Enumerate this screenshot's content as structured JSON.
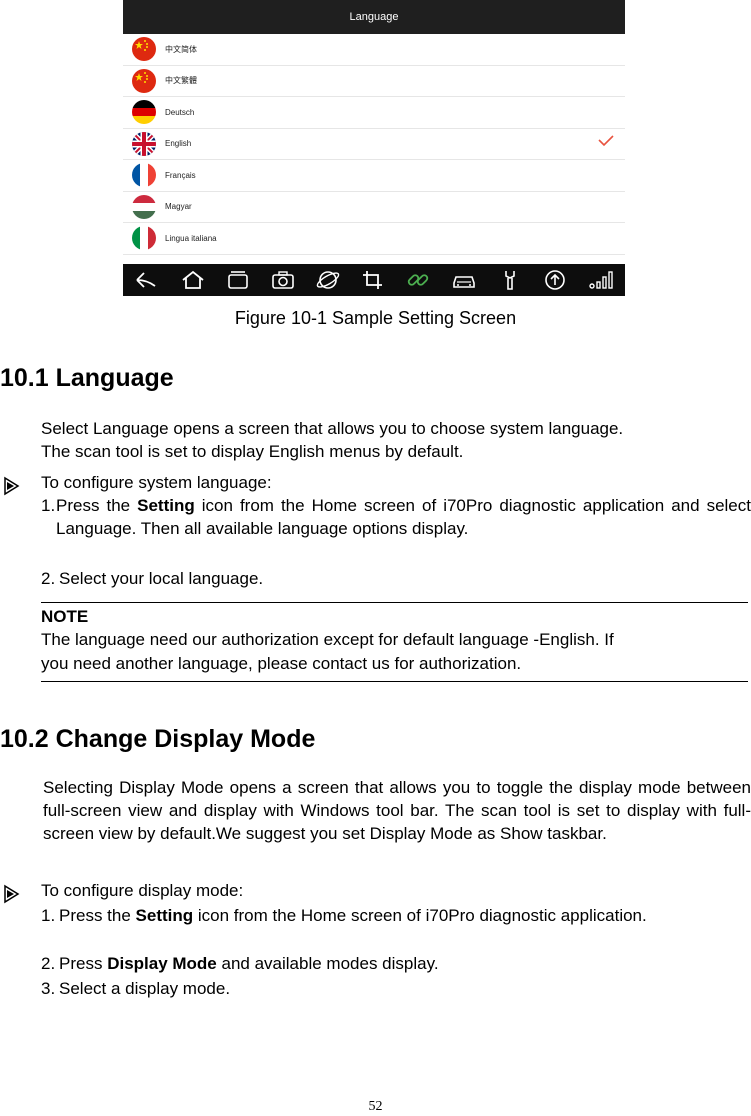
{
  "figure": {
    "screen_title": "Language",
    "languages": [
      {
        "name": "中文简体",
        "flag": "cn-flag",
        "selected": false
      },
      {
        "name": "中文繁體",
        "flag": "cn-flag",
        "selected": false
      },
      {
        "name": "Deutsch",
        "flag": "de-flag",
        "selected": false
      },
      {
        "name": "English",
        "flag": "uk-flag",
        "selected": true
      },
      {
        "name": "Français",
        "flag": "fr-flag",
        "selected": false
      },
      {
        "name": "Magyar",
        "flag": "hu-flag",
        "selected": false
      },
      {
        "name": "Lingua italiana",
        "flag": "it-flag",
        "selected": false
      }
    ],
    "taskbar_icons": [
      "back-icon",
      "home-icon",
      "recent-apps-icon",
      "camera-icon",
      "browser-icon",
      "crop-icon",
      "link-icon",
      "car-icon",
      "wrench-icon",
      "upload-icon",
      "signal-icon"
    ],
    "caption": "Figure 10-1 Sample Setting Screen"
  },
  "section1": {
    "heading": "10.1 Language",
    "intro_line1": "Select Language opens a screen that allows you to choose system language.",
    "intro_line2": "The scan tool is set to display English menus by default.",
    "configure": "To configure system language:",
    "step1_num": "1.",
    "step1_pre": "Press the ",
    "step1_bold": "Setting",
    "step1_post": " icon from the Home screen of i70Pro diagnostic application and select Language. Then all available language options display.",
    "step2_num": "2.",
    "step2": "Select your local language.",
    "note_title": "NOTE",
    "note_line1": "The language need our authorization except for default language -English. If",
    "note_line2": "you need another language, please contact us for authorization."
  },
  "section2": {
    "heading": "10.2 Change Display Mode",
    "intro": "Selecting Display Mode opens a screen that allows you to toggle the display mode between full-screen view and display with Windows tool bar. The scan tool is set to display with full-screen view by default.We suggest you set Display Mode as Show taskbar.",
    "configure": "To configure display mode:",
    "step1_num": "1.",
    "step1_pre": "Press the ",
    "step1_bold": "Setting",
    "step1_post": " icon from the Home screen of i70Pro diagnostic application.",
    "step2_num": "2.",
    "step2_pre": "Press ",
    "step2_bold": "Display Mode",
    "step2_post": " and available modes display.",
    "step3_num": "3.",
    "step3": "Select a display mode."
  },
  "page_number": "52"
}
